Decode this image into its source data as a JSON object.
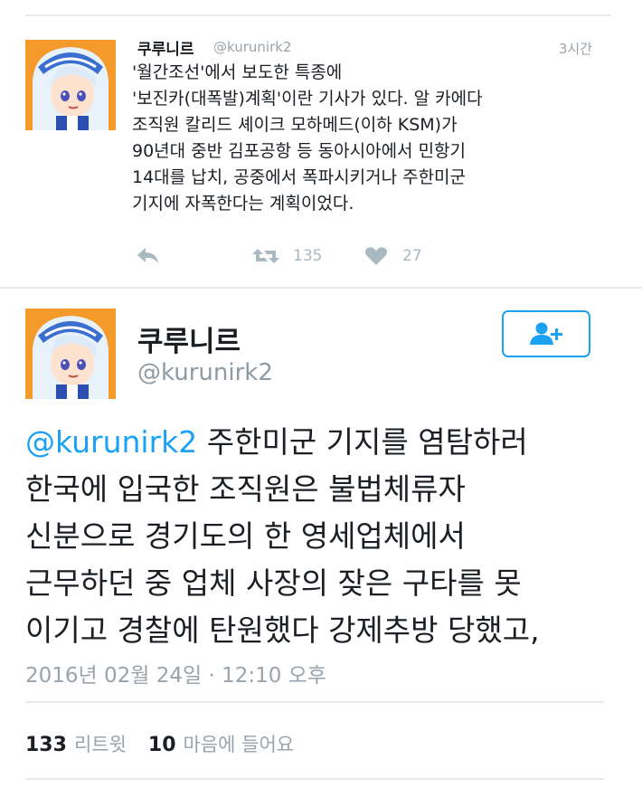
{
  "tweet1": {
    "name": "쿠루니르",
    "handle": "@kurunirk2",
    "time": "3시간",
    "lines": [
      "'월간조선'에서 보도한 특종에",
      "'보진카(대폭발)계획'이란 기사가 있다. 알 카에다",
      "조직원 칼리드 셰이크 모하메드(이하 KSM)가",
      "90년대 중반 김포공항 등 동아시아에서 민항기",
      "14대를 납치, 공중에서 폭파시키거나 주한미군",
      "기지에 자폭한다는 계획이었다."
    ],
    "retweet_count": "135",
    "like_count": "27"
  },
  "tweet2": {
    "name": "쿠루니르",
    "handle": "@kurunirk2",
    "mention": "@kurunirk2",
    "lines": [
      " 주한미군 기지를 염탐하러",
      "한국에 입국한 조직원은 불법체류자",
      "신분으로 경기도의 한 영세업체에서",
      "근무하던 중 업체 사장의 잦은 구타를 못",
      "이기고 경찰에 탄원했다 강제추방 당했고,"
    ],
    "timestamp": "2016년 02월 24일 · 12:10 오후",
    "retweets": "133",
    "retweets_label": "리트윗",
    "likes": "10",
    "likes_label": "마음에 들어요"
  },
  "colors": {
    "accent": "#1da1f2",
    "muted": "#9aa3ab",
    "text": "#1b1f23",
    "divider": "#e7eaed"
  },
  "icons": [
    "reply-icon",
    "retweet-icon",
    "heart-icon",
    "follow-user-icon",
    "avatar"
  ]
}
